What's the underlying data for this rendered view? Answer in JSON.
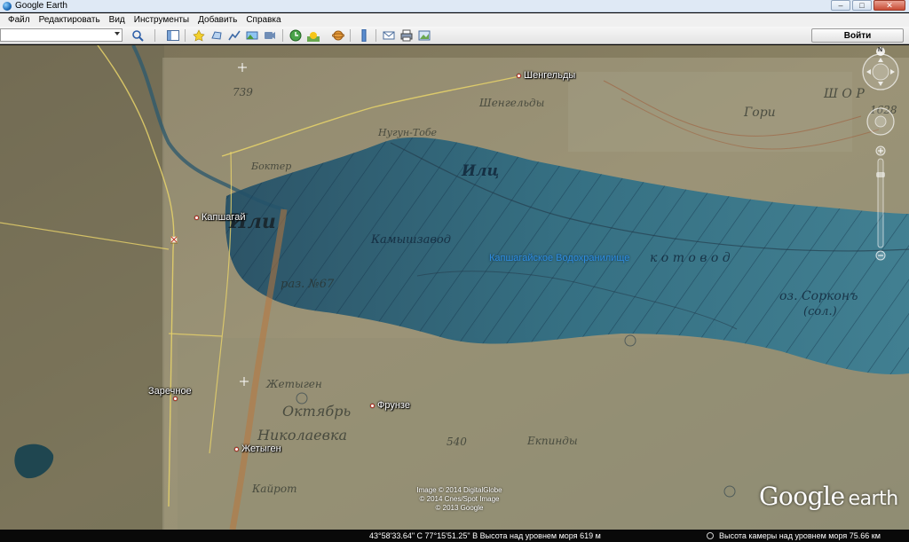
{
  "window": {
    "title": "Google Earth",
    "buttons": {
      "minimize": "‒",
      "maximize": "□",
      "close": "✕"
    }
  },
  "menu": {
    "items": [
      {
        "label": "Файл"
      },
      {
        "label": "Редактировать"
      },
      {
        "label": "Вид"
      },
      {
        "label": "Инструменты"
      },
      {
        "label": "Добавить"
      },
      {
        "label": "Справка"
      }
    ]
  },
  "toolbar": {
    "search_value": "",
    "signin_label": "Войти",
    "icons": [
      "search-icon",
      "sidebar-toggle-icon",
      "placemark-icon",
      "polygon-icon",
      "path-icon",
      "image-overlay-icon",
      "record-tour-icon",
      "historical-imagery-icon",
      "sunlight-icon",
      "planets-icon",
      "ruler-icon",
      "email-icon",
      "print-icon",
      "save-image-icon"
    ]
  },
  "map": {
    "places": [
      {
        "name": "Шенгельды"
      },
      {
        "name": "Капшагай"
      },
      {
        "name": "Заречное"
      },
      {
        "name": "Фрунзе"
      },
      {
        "name": "Жетыген"
      }
    ],
    "water_label": "Капшагайское Водохранилище",
    "attribution": [
      "Image © 2014 DigitalGlobe",
      "© 2014 Cnes/Spot Image",
      "© 2013 Google"
    ],
    "logo_google": "Google",
    "logo_earth": "earth",
    "overlay_labels": [
      {
        "text": "739"
      },
      {
        "text": "Шенгельды"
      },
      {
        "text": "Нугун-Тобе"
      },
      {
        "text": "Боктер"
      },
      {
        "text": "Или"
      },
      {
        "text": "Илц"
      },
      {
        "text": "Камышзавод"
      },
      {
        "text": "раз. №67"
      },
      {
        "text": "к о т о в о д"
      },
      {
        "text": "оз. Сорконъ"
      },
      {
        "text": "(сол.)"
      },
      {
        "text": "Жетыген"
      },
      {
        "text": "Октябрь"
      },
      {
        "text": "Николаевка"
      },
      {
        "text": "540"
      },
      {
        "text": "Екпинды"
      },
      {
        "text": "Кайрот"
      },
      {
        "text": "Гори"
      },
      {
        "text": "1628"
      },
      {
        "text": "Ш О Р"
      }
    ],
    "colors": {
      "water": "#2b6c86",
      "water_overlay": "#1c4a6c",
      "steppe": "#7c7358",
      "roads": "#e8d36a"
    }
  },
  "nav": {
    "north_label": "N"
  },
  "status": {
    "coordinates": "43°58'33.64\" С  77°15'51.25\" В  Высота над уровнем моря  619 м",
    "camera": "Высота камеры над уровнем моря    75.66 км"
  }
}
